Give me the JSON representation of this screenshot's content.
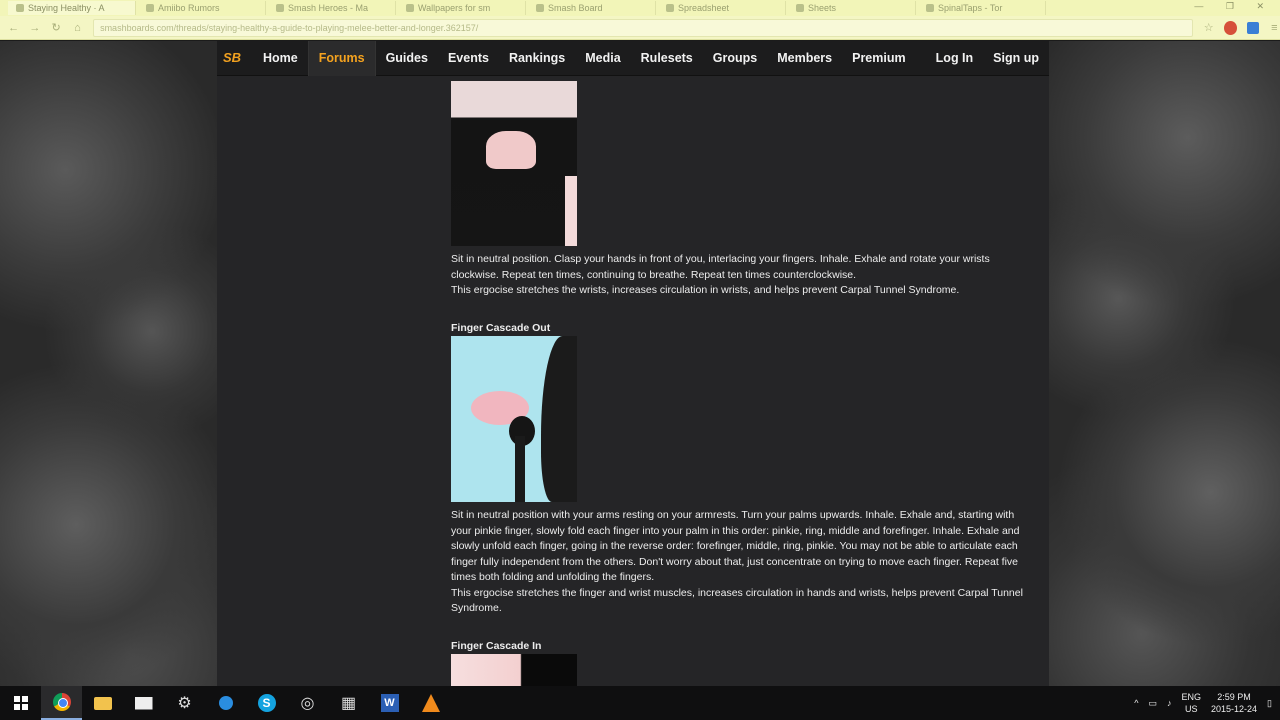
{
  "browser": {
    "tabs": [
      {
        "label": "Staying Healthy · A"
      },
      {
        "label": "Amiibo Rumors"
      },
      {
        "label": "Smash Heroes - Ma"
      },
      {
        "label": "Wallpapers for sm"
      },
      {
        "label": "Smash Board"
      },
      {
        "label": "Spreadsheet"
      },
      {
        "label": "Sheets"
      },
      {
        "label": "SpinalTaps - Tor"
      }
    ],
    "window_controls": "— ❐ ✕",
    "url": "smashboards.com/threads/staying-healthy-a-guide-to-playing-melee-better-and-longer.362157/"
  },
  "site": {
    "logo": "SB",
    "nav": [
      "Home",
      "Forums",
      "Guides",
      "Events",
      "Rankings",
      "Media",
      "Rulesets",
      "Groups",
      "Members",
      "Premium"
    ],
    "active_nav": "Forums",
    "login": "Log In",
    "signup": "Sign up"
  },
  "article": {
    "section1_text": "Sit in neutral position. Clasp your hands in front of you, interlacing your fingers. Inhale. Exhale and rotate your wrists clockwise. Repeat ten times, continuing to breathe. Repeat ten times counterclockwise.",
    "section1_benefit": "This ergocise stretches the wrists, increases circulation in wrists, and helps prevent Carpal Tunnel Syndrome.",
    "section2_heading": "Finger Cascade Out",
    "section2_text": "Sit in neutral position with your arms resting on your armrests. Turn your palms upwards. Inhale. Exhale and, starting with your pinkie finger, slowly fold each finger into your palm in this order: pinkie, ring, middle and forefinger. Inhale. Exhale and slowly unfold each finger, going in the reverse order: forefinger, middle, ring, pinkie. You may not be able to articulate each finger fully independent from the others. Don't worry about that, just concentrate on trying to move each finger. Repeat five times both folding and unfolding the fingers.",
    "section2_benefit": "This ergocise stretches the finger and wrist muscles, increases circulation in hands and wrists, helps prevent Carpal Tunnel Syndrome.",
    "section3_heading": "Finger Cascade In"
  },
  "taskbar": {
    "lang_line1": "ENG",
    "lang_line2": "US",
    "time": "2:59 PM",
    "date": "2015-12-24"
  }
}
